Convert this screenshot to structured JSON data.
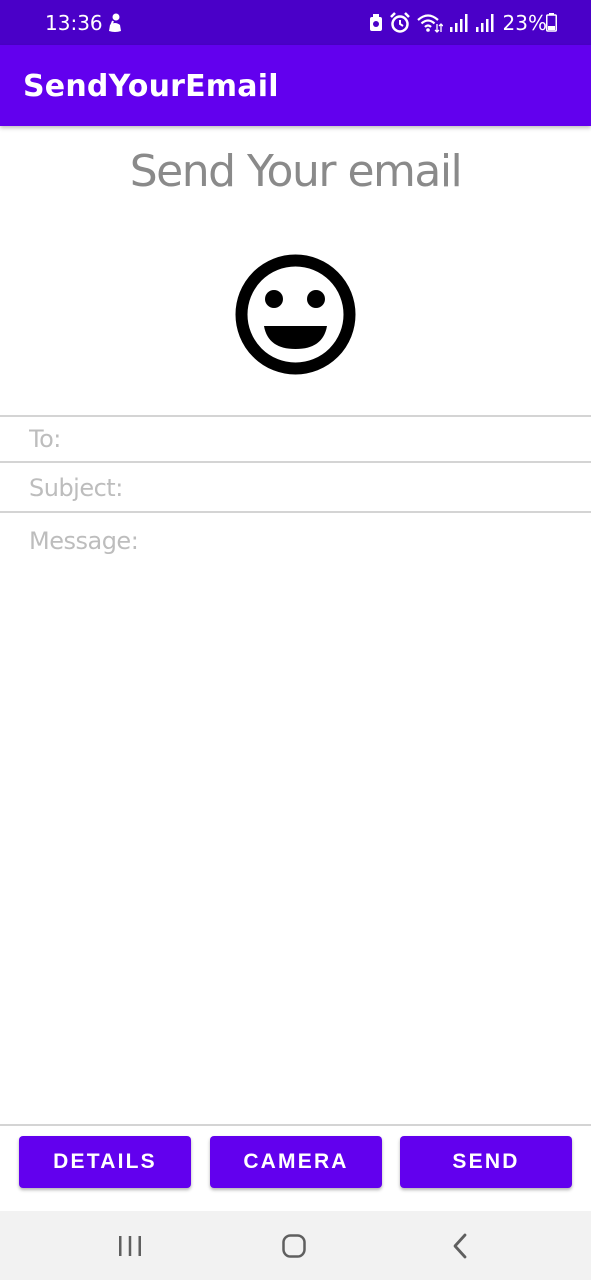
{
  "status_bar": {
    "time": "13:36",
    "battery": "23%"
  },
  "app_bar": {
    "title": "SendYourEmail"
  },
  "main": {
    "heading": "Send Your email",
    "to_placeholder": "To:",
    "subject_placeholder": "Subject:",
    "message_placeholder": "Message:"
  },
  "buttons": {
    "details": "DETAILS",
    "camera": "CAMERA",
    "send": "SEND"
  },
  "colors": {
    "status_bar": "#4a00c8",
    "primary": "#6200ee"
  },
  "icons": {
    "notification": "notification-icon",
    "wifi": "wifi-icon",
    "signal": "signal-icon",
    "battery": "battery-icon",
    "alarm": "alarm-icon",
    "smiley": "smiley-icon",
    "recents": "recents-icon",
    "home": "home-icon",
    "back": "back-icon"
  }
}
